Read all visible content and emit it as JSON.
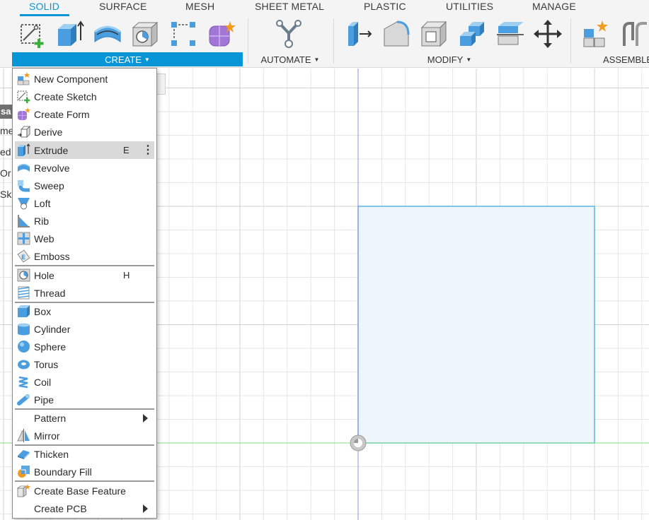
{
  "toolbar": {
    "tabs": [
      "SOLID",
      "SURFACE",
      "MESH",
      "SHEET METAL",
      "PLASTIC",
      "UTILITIES",
      "MANAGE"
    ],
    "active_tab": "SOLID",
    "groups": {
      "create": "CREATE",
      "automate": "AUTOMATE",
      "modify": "MODIFY",
      "assemble": "ASSEMBLE"
    },
    "accent": "#0696d7"
  },
  "browser_fragments": [
    "sa",
    "me",
    "ed",
    "Or",
    "Sk"
  ],
  "create_menu": {
    "items": [
      {
        "label": "New Component",
        "icon": "new-component-icon"
      },
      {
        "label": "Create Sketch",
        "icon": "create-sketch-icon"
      },
      {
        "label": "Create Form",
        "icon": "create-form-icon"
      },
      {
        "label": "Derive",
        "icon": "derive-icon"
      },
      {
        "label": "Extrude",
        "icon": "extrude-icon",
        "shortcut": "E",
        "highlighted": true
      },
      {
        "label": "Revolve",
        "icon": "revolve-icon"
      },
      {
        "label": "Sweep",
        "icon": "sweep-icon"
      },
      {
        "label": "Loft",
        "icon": "loft-icon"
      },
      {
        "label": "Rib",
        "icon": "rib-icon"
      },
      {
        "label": "Web",
        "icon": "web-icon"
      },
      {
        "label": "Emboss",
        "icon": "emboss-icon"
      },
      {
        "label": "Hole",
        "icon": "hole-icon",
        "shortcut": "H"
      },
      {
        "label": "Thread",
        "icon": "thread-icon"
      },
      {
        "label": "Box",
        "icon": "box-icon"
      },
      {
        "label": "Cylinder",
        "icon": "cylinder-icon"
      },
      {
        "label": "Sphere",
        "icon": "sphere-icon"
      },
      {
        "label": "Torus",
        "icon": "torus-icon"
      },
      {
        "label": "Coil",
        "icon": "coil-icon"
      },
      {
        "label": "Pipe",
        "icon": "pipe-icon"
      },
      {
        "label": "Pattern",
        "submenu": true
      },
      {
        "label": "Mirror",
        "icon": "mirror-icon"
      },
      {
        "label": "Thicken",
        "icon": "thicken-icon"
      },
      {
        "label": "Boundary Fill",
        "icon": "boundary-fill-icon"
      },
      {
        "label": "Create Base Feature",
        "icon": "create-base-feature-icon"
      },
      {
        "label": "Create PCB",
        "submenu": true
      }
    ],
    "highlight_color": "#d9d9d9"
  },
  "canvas": {
    "sketch_fill": "#eef5fb",
    "sketch_stroke": "#58b4e0",
    "grid_color": "#e6e6e6",
    "x_axis_color": "#7fe07f",
    "y_axis_color": "#8f8fe6"
  }
}
